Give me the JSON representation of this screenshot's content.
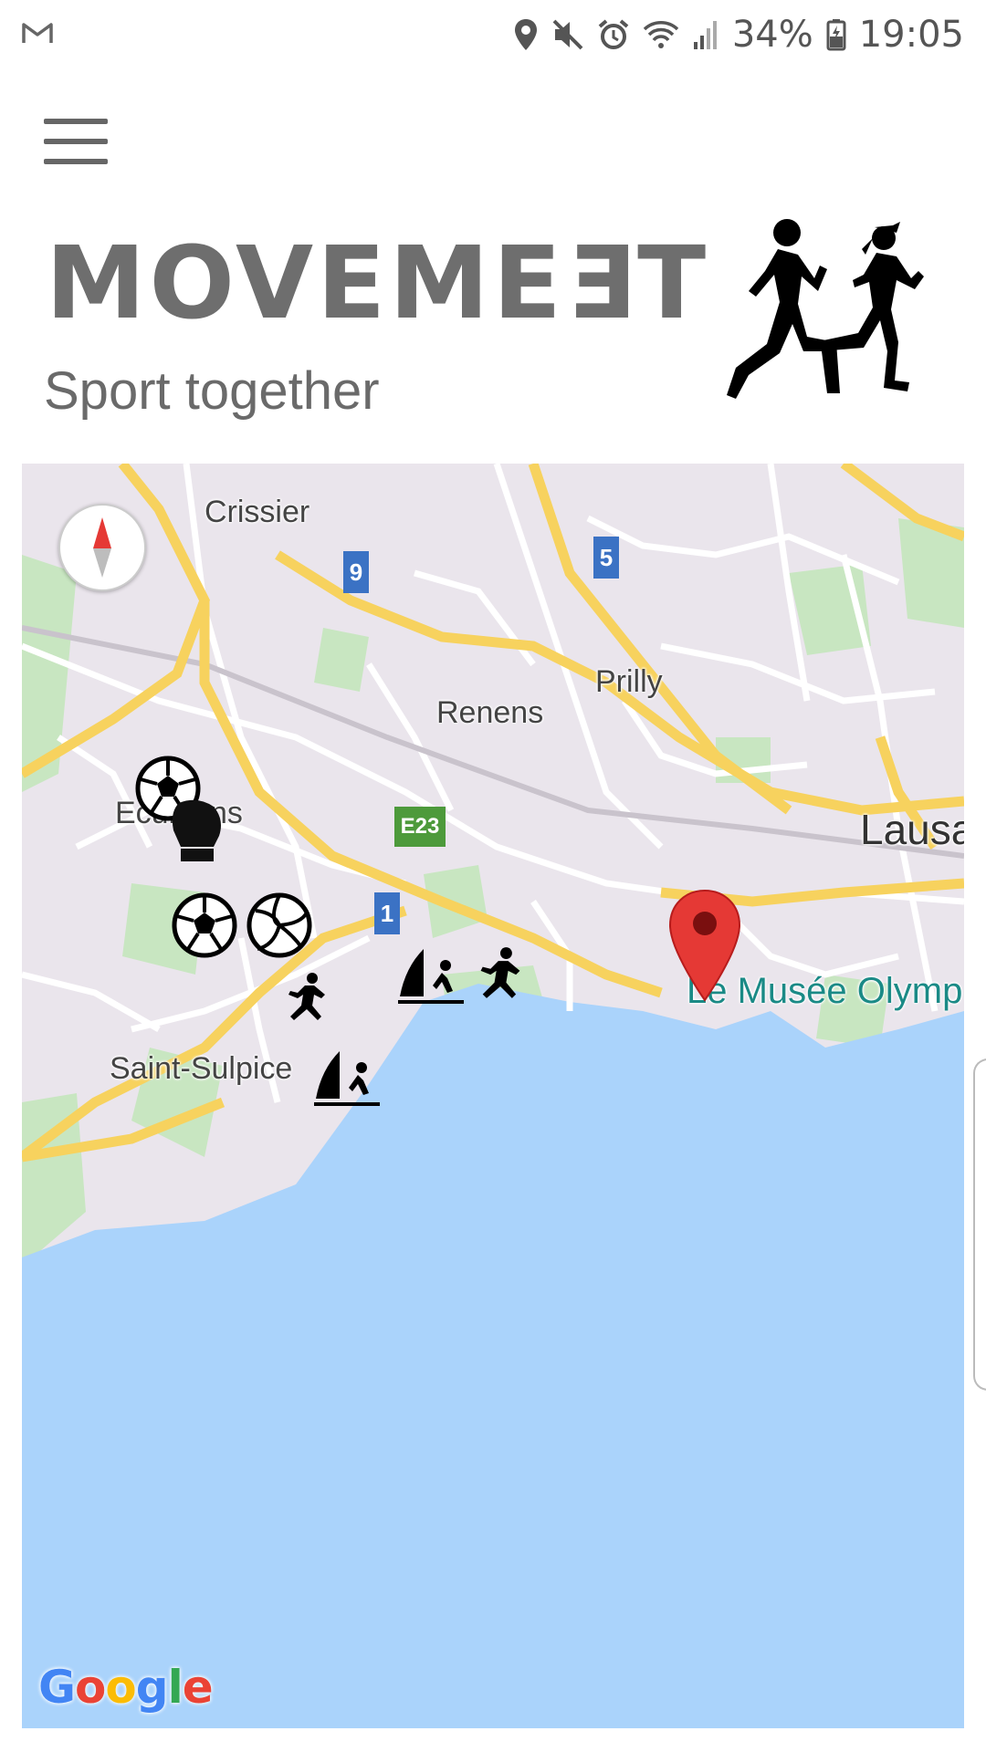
{
  "status_bar": {
    "battery": "34%",
    "time": "19:05",
    "icons": [
      "gmail-icon",
      "location-icon",
      "mute-icon",
      "alarm-icon",
      "wifi-icon",
      "signal-icon",
      "battery-icon"
    ]
  },
  "header": {
    "menu_icon": "hamburger-menu-icon",
    "logo_prefix": "MOVEME",
    "logo_mirrored": "E",
    "logo_suffix": "T",
    "tagline": "Sport together"
  },
  "map": {
    "places": {
      "crissier": "Crissier",
      "prilly": "Prilly",
      "renens": "Renens",
      "ecublens": "Ecublens",
      "lausanne": "Lausa",
      "saint_sulpice": "Saint-Sulpice",
      "musee": "Le Musée Olymp"
    },
    "shields": {
      "r9": "9",
      "r5": "5",
      "e23": "E23",
      "r1": "1"
    },
    "markers": [
      "soccer",
      "boxing",
      "soccer",
      "volleyball",
      "running",
      "windsurfing",
      "running",
      "windsurfing"
    ],
    "colors": {
      "water": "#aad3fb",
      "land": "#eae5ec",
      "highway": "#f7d25e",
      "park": "#c8e6c1",
      "pin": "#e53935"
    },
    "attribution": {
      "g1": "G",
      "o1": "o",
      "o2": "o",
      "g2": "g",
      "l": "l",
      "e": "e"
    }
  }
}
